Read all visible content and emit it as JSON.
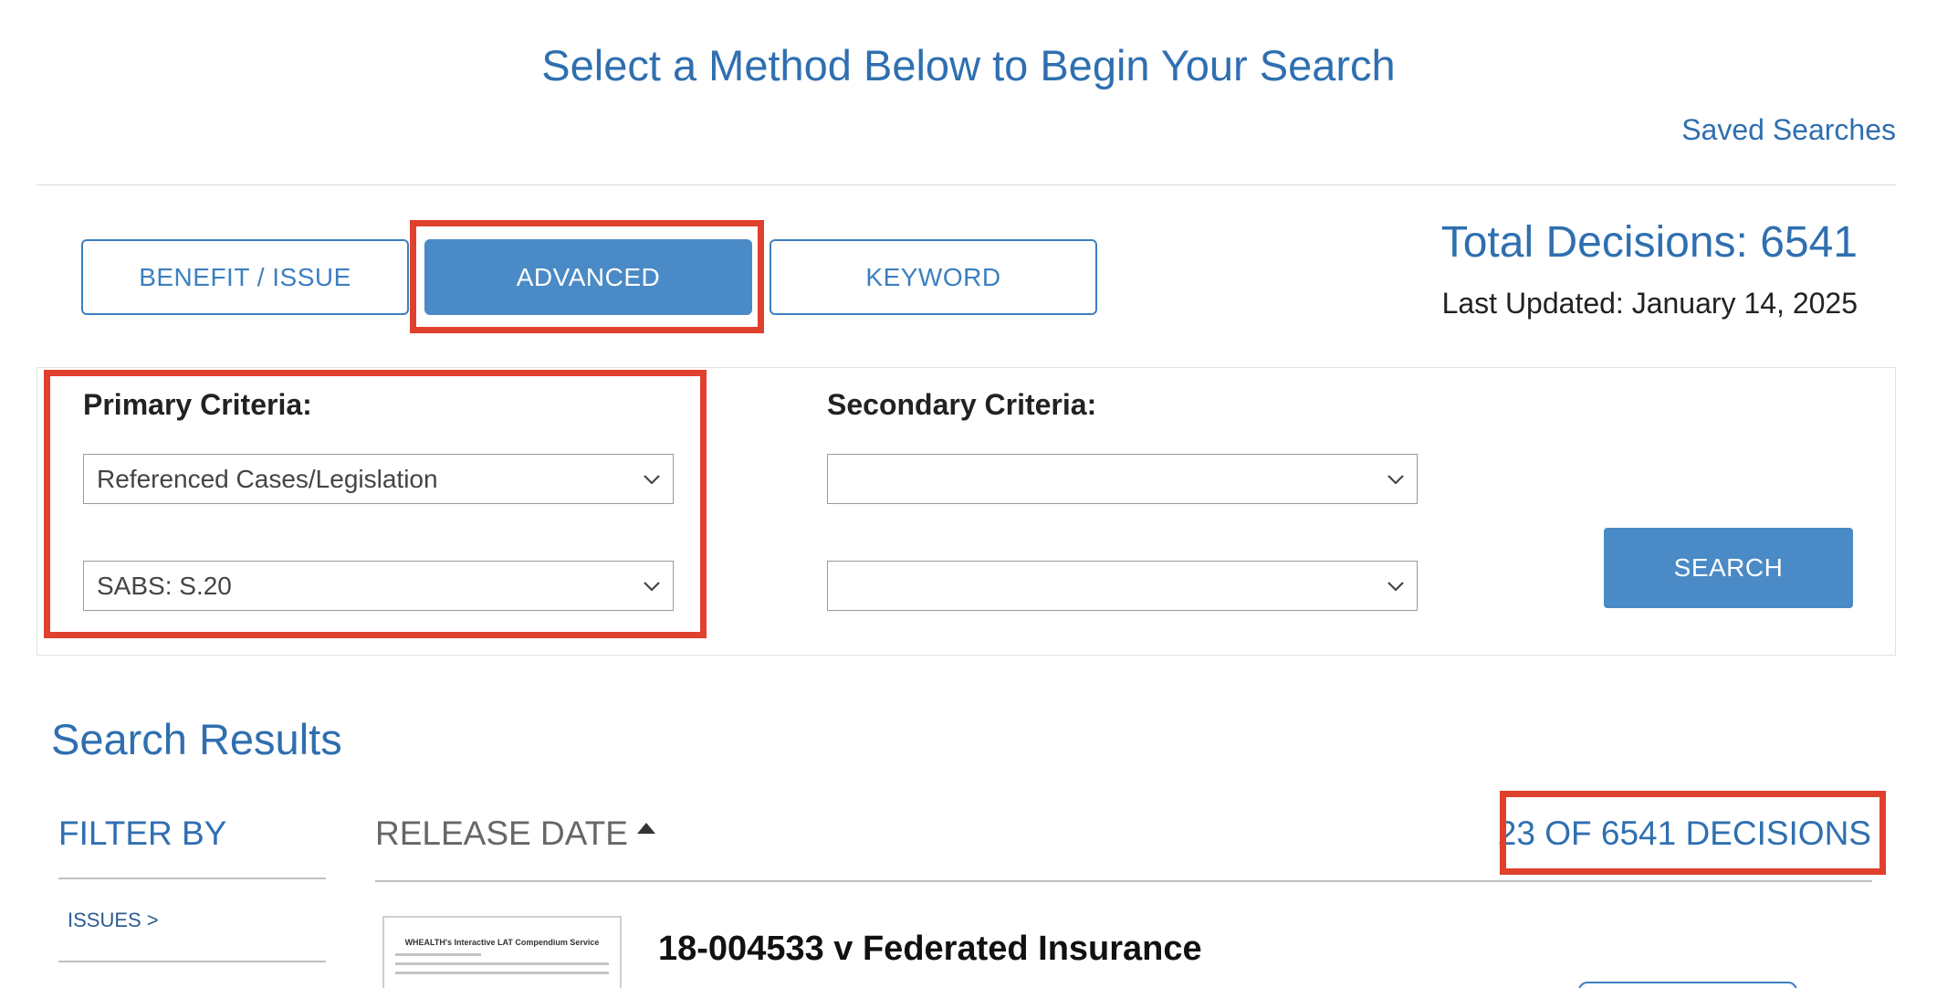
{
  "header": {
    "title": "Select a Method Below to Begin Your Search",
    "saved_searches": "Saved Searches"
  },
  "tabs": [
    {
      "label": "BENEFIT / ISSUE",
      "active": false
    },
    {
      "label": "ADVANCED",
      "active": true
    },
    {
      "label": "KEYWORD",
      "active": false
    }
  ],
  "stats": {
    "total_decisions": "Total Decisions: 6541",
    "last_updated": "Last Updated: January 14, 2025"
  },
  "criteria": {
    "primary_label": "Primary Criteria:",
    "primary_1": "Referenced Cases/Legislation",
    "primary_2": "SABS: S.20",
    "secondary_label": "Secondary Criteria:",
    "secondary_1": "",
    "secondary_2": "",
    "search_button": "SEARCH"
  },
  "results": {
    "title": "Search Results",
    "filter_by": "FILTER BY",
    "filter_items": [
      "ISSUES >"
    ],
    "sort_label": "RELEASE DATE",
    "count": "23 OF 6541 DECISIONS",
    "items": [
      {
        "title": "18-004533 v Federated Insurance",
        "thumb_heading": "WHEALTH's Interactive LAT Compendium Service"
      }
    ]
  },
  "colors": {
    "accent": "#2f6fb0",
    "button": "#4a8ac6",
    "highlight": "#e0402e"
  },
  "icons": {
    "select_arrow": "chevron-down-icon",
    "sort": "caret-up-icon"
  }
}
